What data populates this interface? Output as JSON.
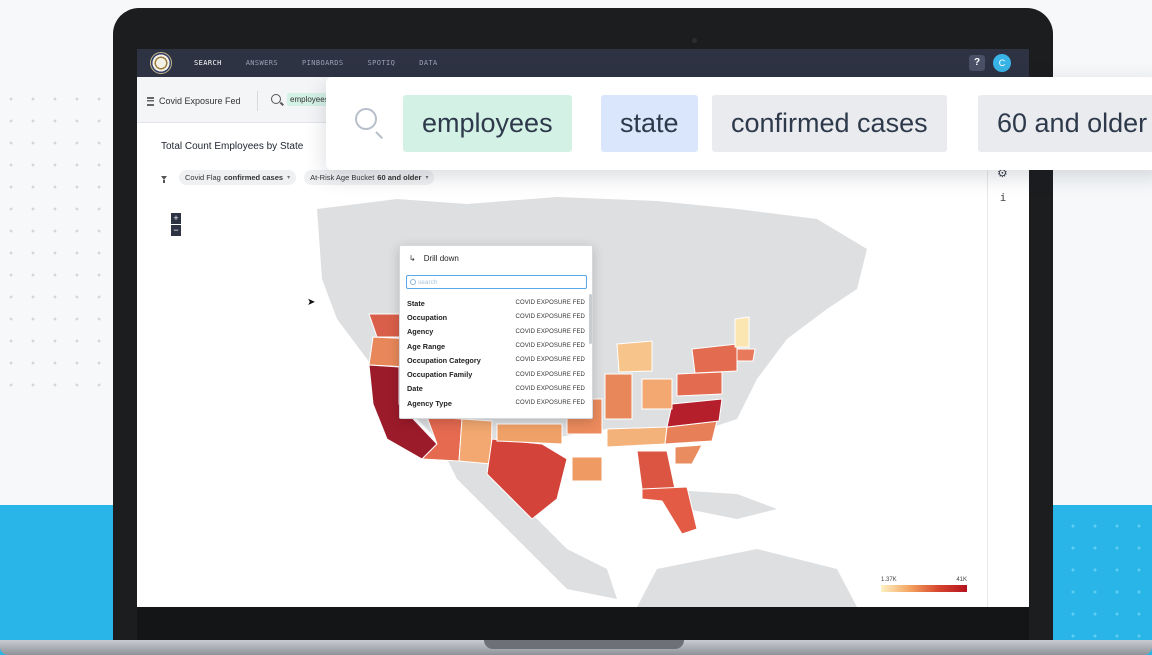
{
  "nav": {
    "items": [
      "SEARCH",
      "ANSWERS",
      "PINBOARDS",
      "SPOTIQ",
      "DATA"
    ],
    "active": "SEARCH",
    "help_label": "?",
    "avatar_initial": "C"
  },
  "search_bar": {
    "source": "Covid Exposure Fed",
    "mini_token": "employees",
    "tokens": [
      "employees",
      "state",
      "confirmed cases",
      "60 and older"
    ]
  },
  "answer": {
    "title": "Total Count Employees by State",
    "filters": [
      {
        "label": "Covid Flag",
        "value": "confirmed cases"
      },
      {
        "label": "At-Risk Age Bucket",
        "value": "60 and older"
      }
    ],
    "zoom_in": "+",
    "zoom_out": "−",
    "info_glyph": "i"
  },
  "drill_down": {
    "title": "Drill down",
    "search_placeholder": "search",
    "items": [
      {
        "column": "State",
        "source": "COVID EXPOSURE FED"
      },
      {
        "column": "Occupation",
        "source": "COVID EXPOSURE FED"
      },
      {
        "column": "Agency",
        "source": "COVID EXPOSURE FED"
      },
      {
        "column": "Age Range",
        "source": "COVID EXPOSURE FED"
      },
      {
        "column": "Occupation Category",
        "source": "COVID EXPOSURE FED"
      },
      {
        "column": "Occupation Family",
        "source": "COVID EXPOSURE FED"
      },
      {
        "column": "Date",
        "source": "COVID EXPOSURE FED"
      },
      {
        "column": "Agency Type",
        "source": "COVID EXPOSURE FED"
      }
    ]
  },
  "legend": {
    "min_label": "1.37K",
    "max_label": "41K"
  },
  "colors": {
    "accent": "#29b5e8",
    "nav_bg": "#2e3344",
    "token_green": "#d4f1e6",
    "token_blue": "#d9e6fb",
    "token_gray": "#e9ebee",
    "scale_low": "#fdf1c3",
    "scale_high": "#b4131f"
  }
}
